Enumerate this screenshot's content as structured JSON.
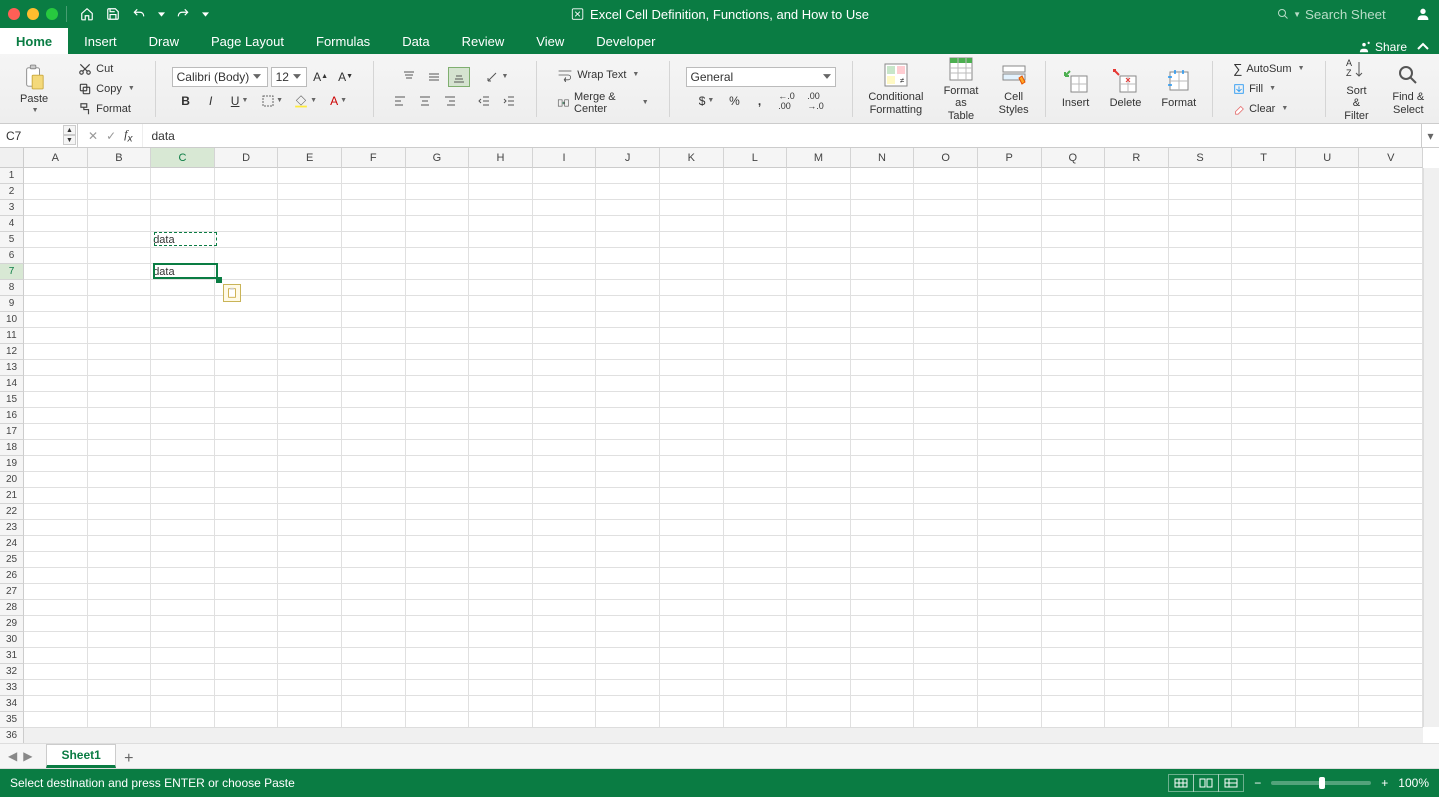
{
  "window": {
    "title": "Excel Cell Definition, Functions, and How to Use",
    "search_placeholder": "Search Sheet"
  },
  "tabs": {
    "items": [
      "Home",
      "Insert",
      "Draw",
      "Page Layout",
      "Formulas",
      "Data",
      "Review",
      "View",
      "Developer"
    ],
    "active": "Home",
    "share": "Share"
  },
  "ribbon": {
    "paste": "Paste",
    "cut": "Cut",
    "copy": "Copy",
    "format": "Format",
    "font_name": "Calibri (Body)",
    "font_size": "12",
    "wrap_text": "Wrap Text",
    "merge_center": "Merge & Center",
    "number_format": "General",
    "cond_fmt": "Conditional Formatting",
    "fmt_table": "Format as Table",
    "cell_styles": "Cell Styles",
    "insert": "Insert",
    "delete": "Delete",
    "format_btn": "Format",
    "autosum": "AutoSum",
    "fill": "Fill",
    "clear": "Clear",
    "sort_filter": "Sort & Filter",
    "find_select": "Find & Select"
  },
  "formula_bar": {
    "cell_ref": "C7",
    "value": "data"
  },
  "grid": {
    "columns": [
      "A",
      "B",
      "C",
      "D",
      "E",
      "F",
      "G",
      "H",
      "I",
      "J",
      "K",
      "L",
      "M",
      "N",
      "O",
      "P",
      "Q",
      "R",
      "S",
      "T",
      "U",
      "V"
    ],
    "rows": 36,
    "active_col_idx": 2,
    "active_row_idx": 6,
    "cells": {
      "C5": "data",
      "C7": "data"
    },
    "copy_source": {
      "col": 2,
      "row": 4
    },
    "selection": {
      "col": 2,
      "row": 6
    }
  },
  "sheets": {
    "active": "Sheet1"
  },
  "status": {
    "message": "Select destination and press ENTER or choose Paste",
    "zoom": "100%"
  }
}
